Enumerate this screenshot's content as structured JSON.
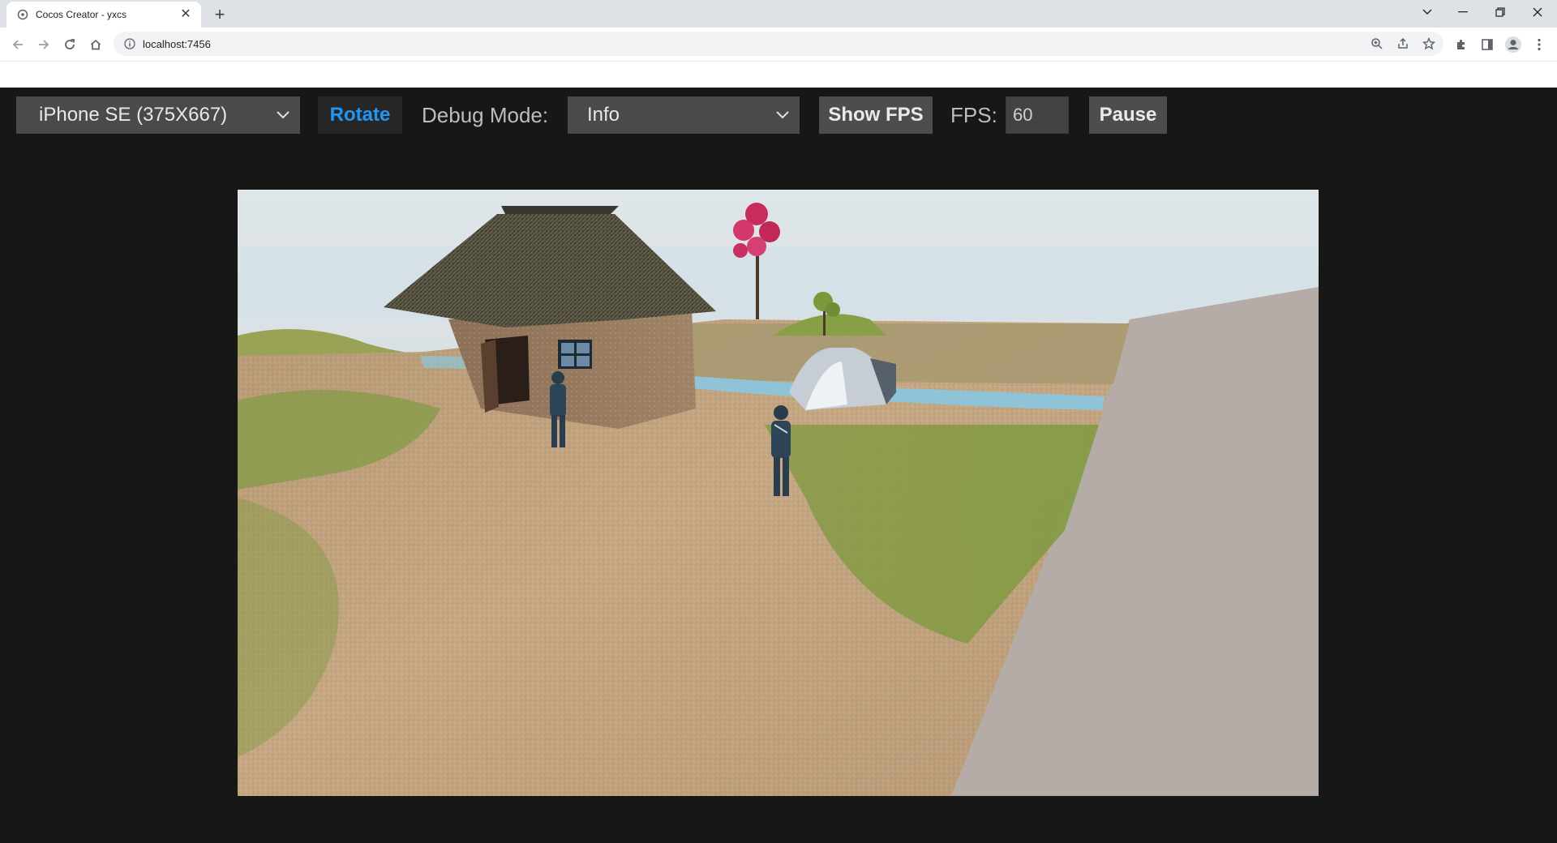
{
  "browser": {
    "tab_title": "Cocos Creator - yxcs",
    "url": "localhost:7456"
  },
  "icons": {
    "tab_favicon": "cocos-favicon-icon",
    "tab_close": "close-icon",
    "new_tab": "plus-icon",
    "back": "arrow-left-icon",
    "forward": "arrow-right-icon",
    "reload": "reload-icon",
    "home": "home-icon",
    "site_info": "info-icon",
    "zoom": "zoom-icon",
    "share": "share-icon",
    "bookmark": "star-icon",
    "extensions": "puzzle-icon",
    "side_panel": "side-panel-icon",
    "profile": "profile-icon",
    "menu": "kebab-menu-icon"
  },
  "preview": {
    "device_select": "iPhone SE (375X667)",
    "rotate_label": "Rotate",
    "debug_mode_label": "Debug Mode:",
    "debug_mode_value": "Info",
    "show_fps_label": "Show FPS",
    "fps_label": "FPS:",
    "fps_value": "60",
    "pause_label": "Pause"
  },
  "colors": {
    "rotate_accent": "#2196f3",
    "panel_bg": "#171717",
    "control_bg": "#4a4a4a"
  }
}
